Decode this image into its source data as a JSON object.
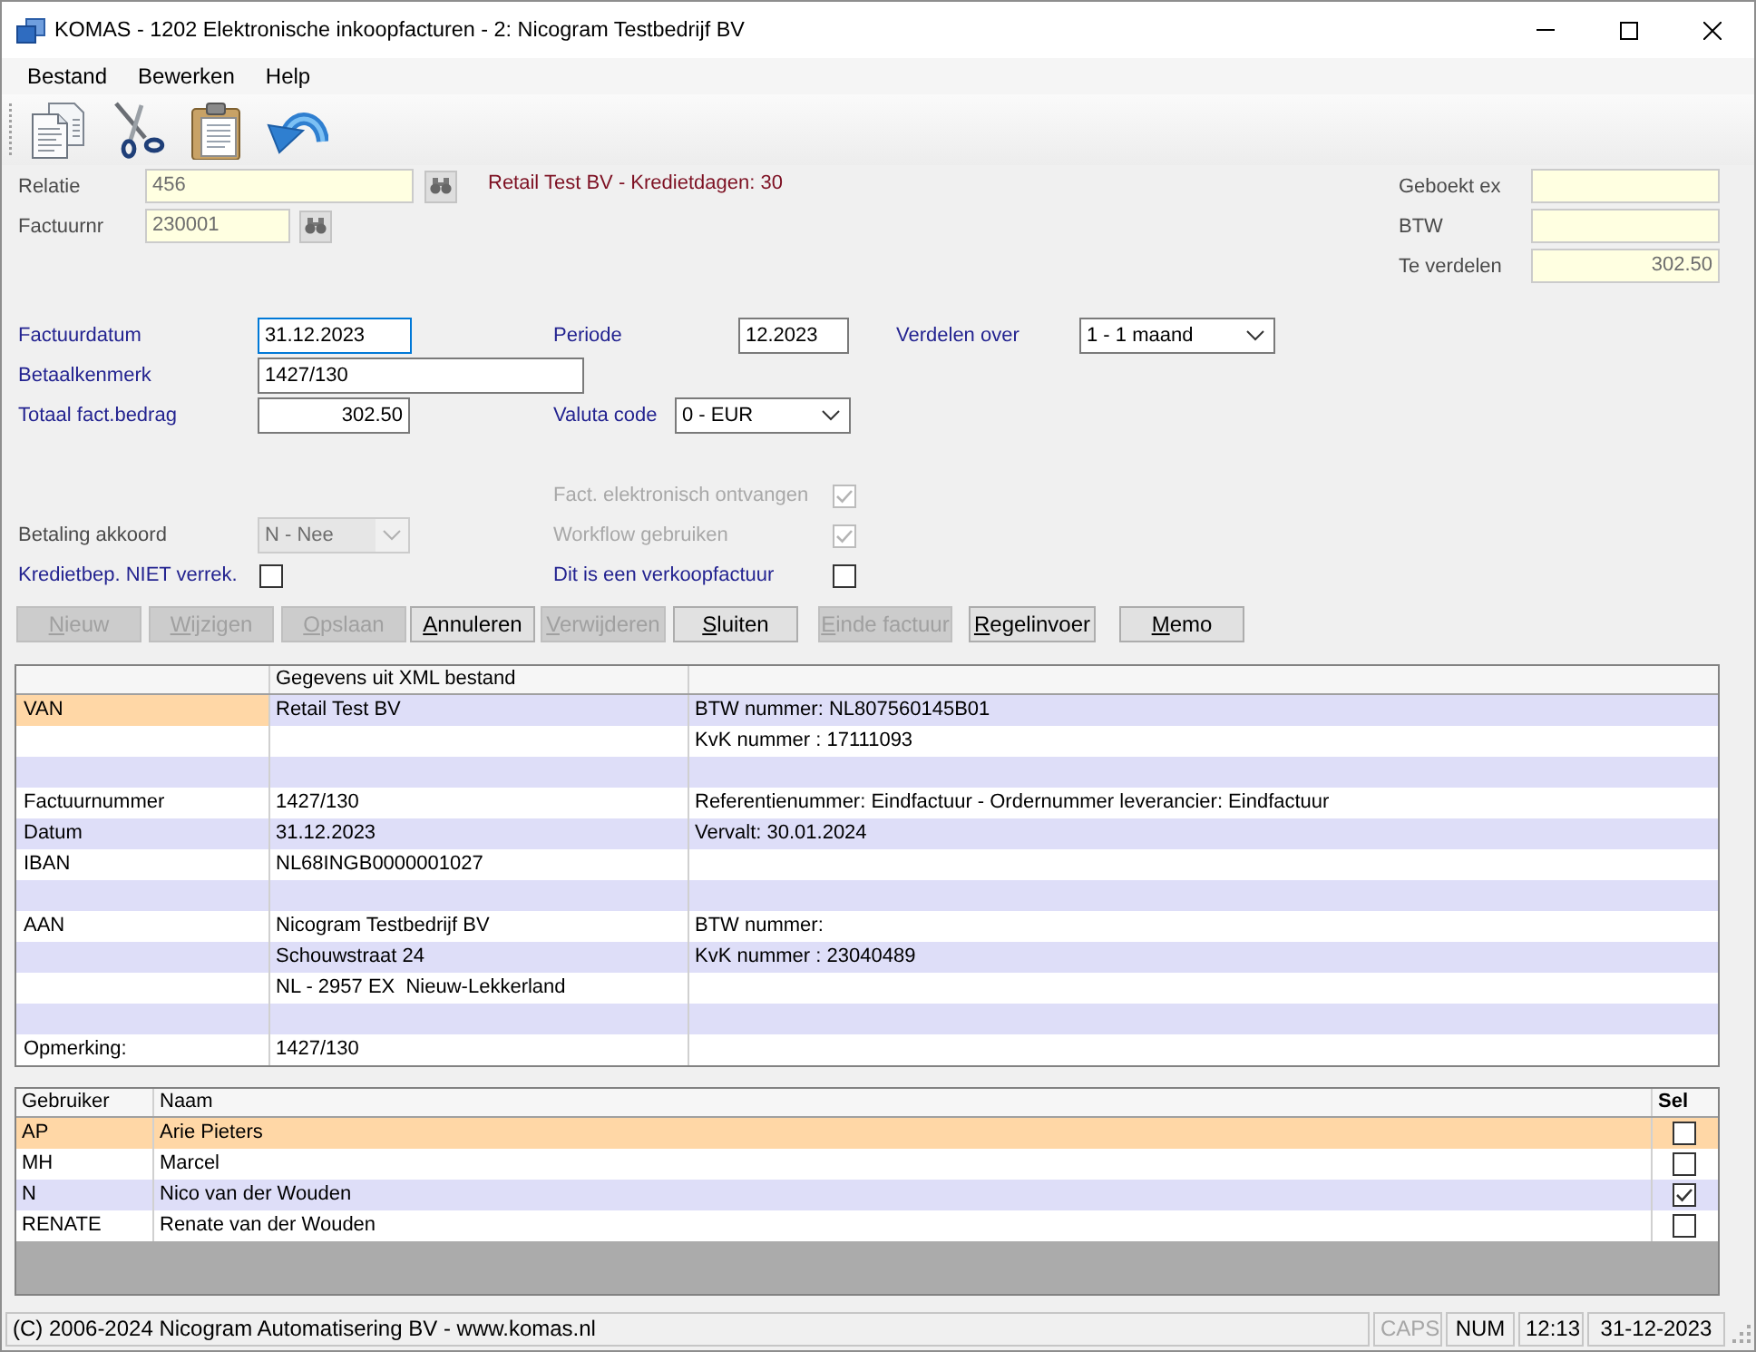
{
  "window": {
    "title": "KOMAS - 1202 Elektronische inkoopfacturen - 2: Nicogram Testbedrijf BV"
  },
  "menu": [
    {
      "label": "Bestand"
    },
    {
      "label": "Bewerken"
    },
    {
      "label": "Help"
    }
  ],
  "lookup": {
    "relatie": {
      "label": "Relatie",
      "value": "456"
    },
    "factuurnr": {
      "label": "Factuurnr",
      "value": "230001"
    },
    "relation_info": "Retail Test BV - Kredietdagen: 30"
  },
  "totals": [
    {
      "label": "Geboekt ex"
    },
    {
      "label": "BTW"
    },
    {
      "label": "Te verdelen",
      "value": "302.50"
    }
  ],
  "invoice": {
    "factuurdatum": {
      "label": "Factuurdatum",
      "value": "31.12.2023",
      "focused": true
    },
    "periode": {
      "label": "Periode",
      "value": "12.2023",
      "focused": false
    },
    "verdelen_over": {
      "label": "Verdelen over",
      "value": "1 - 1 maand",
      "disabled": false
    },
    "betaalkenmerk": {
      "label": "Betaalkenmerk",
      "value": "1427/130",
      "focused": false
    },
    "totaal_bedrag": {
      "label": "Totaal fact.bedrag",
      "value": "302.50",
      "focused": false
    },
    "valuta_code": {
      "label": "Valuta code",
      "value": "0 - EUR",
      "disabled": false
    },
    "elektronisch_ontvangen": {
      "label": "Fact. elektronisch ontvangen",
      "checked": true,
      "disabled": true
    },
    "betaling_akkoord": {
      "label": "Betaling akkoord",
      "value": "N - Nee",
      "disabled": true
    },
    "workflow_gebruiken": {
      "label": "Workflow gebruiken",
      "checked": true,
      "disabled": true
    },
    "kredietbep_niet_verrekenen": {
      "label": "Kredietbep. NIET verrek.",
      "checked": false,
      "disabled": false
    },
    "verkoopfactuur": {
      "label": "Dit is een verkoopfactuur",
      "checked": false,
      "disabled": false
    }
  },
  "buttons": [
    {
      "label": "Nieuw",
      "disabled": true
    },
    {
      "label": "Wijzigen",
      "disabled": true
    },
    {
      "label": "Opslaan",
      "disabled": true
    },
    {
      "label": "Annuleren",
      "disabled": false
    },
    {
      "label": "Verwijderen",
      "disabled": true
    },
    {
      "label": "Sluiten",
      "disabled": false
    },
    {
      "label": "Einde factuur",
      "disabled": true
    },
    {
      "label": "Regelinvoer",
      "disabled": false
    },
    {
      "label": "Memo",
      "disabled": false
    }
  ],
  "xml_grid": {
    "heading": "Gegevens uit XML bestand",
    "rows": [
      {
        "column_1": "VAN",
        "column_2": "Retail Test BV",
        "column_3": "BTW nummer: NL807560145B01",
        "selected": true
      },
      {
        "column_3": "KvK nummer : 17111093",
        "selected": false
      },
      {
        "selected": false
      },
      {
        "column_1": "Factuurnummer",
        "column_2": "1427/130",
        "column_3": "Referentienummer: Eindfactuur - Ordernummer leverancier: Eindfactuur",
        "selected": false
      },
      {
        "column_1": "Datum",
        "column_2": "31.12.2023",
        "column_3": "Vervalt: 30.01.2024",
        "selected": false
      },
      {
        "column_1": "IBAN",
        "column_2": "NL68INGB0000001027",
        "selected": false
      },
      {
        "selected": false
      },
      {
        "column_1": "AAN",
        "column_2": "Nicogram Testbedrijf BV",
        "column_3": "BTW nummer:",
        "selected": false
      },
      {
        "column_2": "Schouwstraat 24",
        "column_3": "KvK nummer : 23040489",
        "selected": false
      },
      {
        "column_2": "NL - 2957 EX  Nieuw-Lekkerland",
        "selected": false
      },
      {
        "selected": false
      },
      {
        "column_1": "Opmerking:",
        "column_2": "1427/130",
        "selected": false
      }
    ]
  },
  "users_grid": {
    "columns": [
      "Gebruiker",
      "Naam",
      "Sel"
    ],
    "rows": [
      {
        "gebruiker": "AP",
        "naam": "Arie Pieters",
        "checked": false,
        "selected": true
      },
      {
        "gebruiker": "MH",
        "naam": "Marcel",
        "checked": false,
        "selected": false
      },
      {
        "gebruiker": "N",
        "naam": "Nico van der Wouden",
        "checked": true,
        "selected": false
      },
      {
        "gebruiker": "RENATE",
        "naam": "Renate van der Wouden",
        "checked": false,
        "selected": false
      }
    ]
  },
  "status_bar": {
    "text": "(C) 2006-2024 Nicogram Automatisering BV - www.komas.nl",
    "indicators": [
      {
        "label": "CAPS",
        "on": false
      },
      {
        "label": "NUM",
        "on": true
      }
    ],
    "time": "12:13",
    "date": "31-12-2023"
  }
}
